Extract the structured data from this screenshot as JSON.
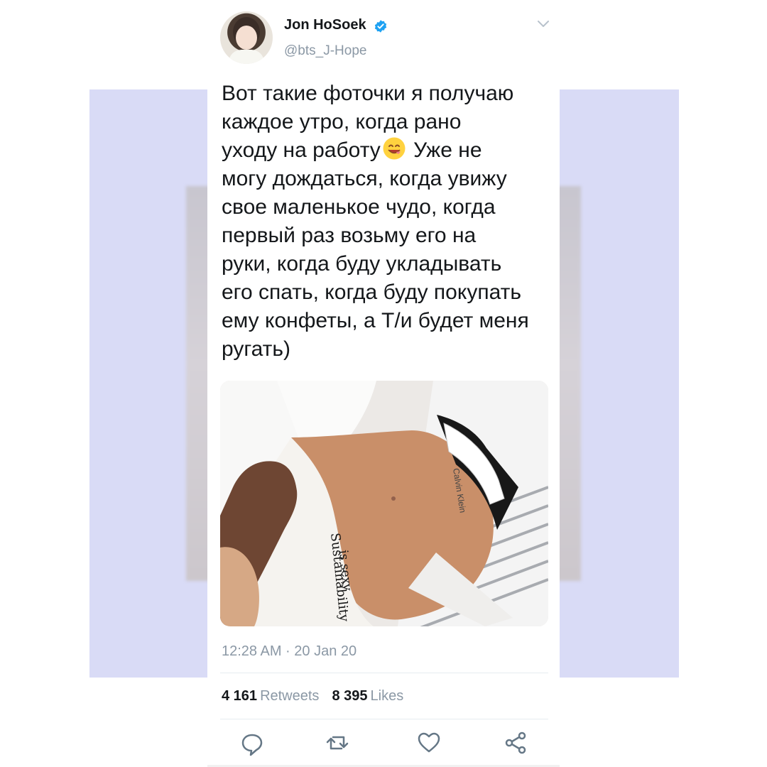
{
  "tweet": {
    "author": {
      "display_name": "Jon HoSoek",
      "handle": "@bts_J-Hope",
      "verified_icon": "verified-badge-icon",
      "avatar_icon": "avatar"
    },
    "text_lines": [
      "Вот такие фоточки я получаю",
      "каждое утро, когда рано",
      "уходу на работу",
      " Уже не",
      "могу дождаться, когда увижу",
      "свое маленькое чудо, когда",
      "первый раз возьму его на",
      "руки, когда буду укладывать",
      "его спать, когда буду покупать",
      "ему конфеты, а Т/и будет меня",
      "ругать)"
    ],
    "media_text": {
      "shirt_text_1": "Sustainability",
      "shirt_text_2": "is sexy",
      "waistband_text": "Calvin Klein"
    },
    "timestamp": "12:28 AM · 20 Jan 20",
    "stats": {
      "retweets_count": "4 161",
      "retweets_label": "Retweets",
      "likes_count": "8 395",
      "likes_label": "Likes"
    },
    "actions": [
      "reply-icon",
      "retweet-icon",
      "like-icon",
      "share-icon"
    ],
    "colors": {
      "background_band": "#d9dbf6",
      "text_primary": "#14171a",
      "text_secondary": "#8b98a5",
      "verified": "#1da1f2",
      "divider": "#e6ecf0"
    }
  }
}
